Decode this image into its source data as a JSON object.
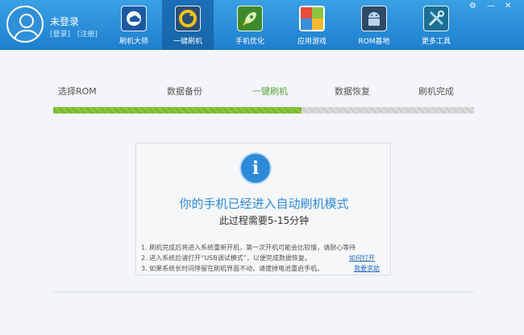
{
  "user": {
    "name": "未登录",
    "login": "[登录]",
    "register": "[注册]"
  },
  "nav": [
    {
      "label": "刷机大师",
      "icon": "cloud-icon",
      "active": false
    },
    {
      "label": "一键刷机",
      "icon": "refresh-icon",
      "active": true
    },
    {
      "label": "手机优化",
      "icon": "rocket-icon",
      "active": false
    },
    {
      "label": "应用游戏",
      "icon": "apps-grid-icon",
      "active": false
    },
    {
      "label": "ROM基地",
      "icon": "android-icon",
      "active": false
    },
    {
      "label": "更多工具",
      "icon": "tools-icon",
      "active": false
    }
  ],
  "steps": [
    "选择ROM",
    "数据备份",
    "一键刷机",
    "数据恢复",
    "刷机完成"
  ],
  "active_step": 2,
  "progress": 0.59,
  "panel": {
    "title": "你的手机已经进入自动刷机模式",
    "subtitle": "此过程需要5-15分钟",
    "notes": [
      "1. 刷机完成后将进入系统重新开机，第一次开机可能会比较慢，请耐心等待",
      "2. 进入系统后请打开“USB调试模式”，以便完成数据恢复。",
      "3. 如果系统长时间停留在刷机界面不动，请拔掉电池重启手机。"
    ],
    "link_open": "如何打开",
    "link_help": "我要求助"
  },
  "colors": {
    "header": "#1d7fcf",
    "accent": "#2f8ad8",
    "progress": "#8cc63f"
  }
}
